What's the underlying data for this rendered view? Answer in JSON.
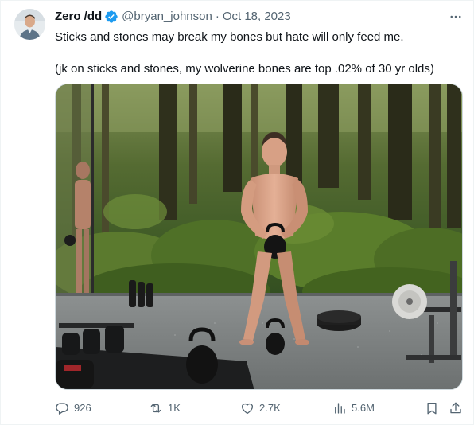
{
  "tweet": {
    "author_name": "Zero /dd",
    "handle": "@bryan_johnson",
    "separator": "·",
    "date": "Oct 18, 2023",
    "text_line1": "Sticks and stones may break my bones but hate will only feed me.",
    "text_line2": "(jk on sticks and stones, my wolverine bones are top .02% of 30 yr olds)"
  },
  "actions": {
    "replies": "926",
    "reposts": "1K",
    "likes": "2.7K",
    "views": "5.6M"
  },
  "icons": {
    "verified": "verified-badge-icon",
    "more": "more-horizontal-icon",
    "reply": "reply-icon",
    "repost": "repost-icon",
    "like": "heart-icon",
    "views": "views-chart-icon",
    "bookmark": "bookmark-icon",
    "share": "share-icon"
  },
  "colors": {
    "text_primary": "#0f1419",
    "text_secondary": "#536471",
    "verified_blue": "#1d9bf0"
  }
}
